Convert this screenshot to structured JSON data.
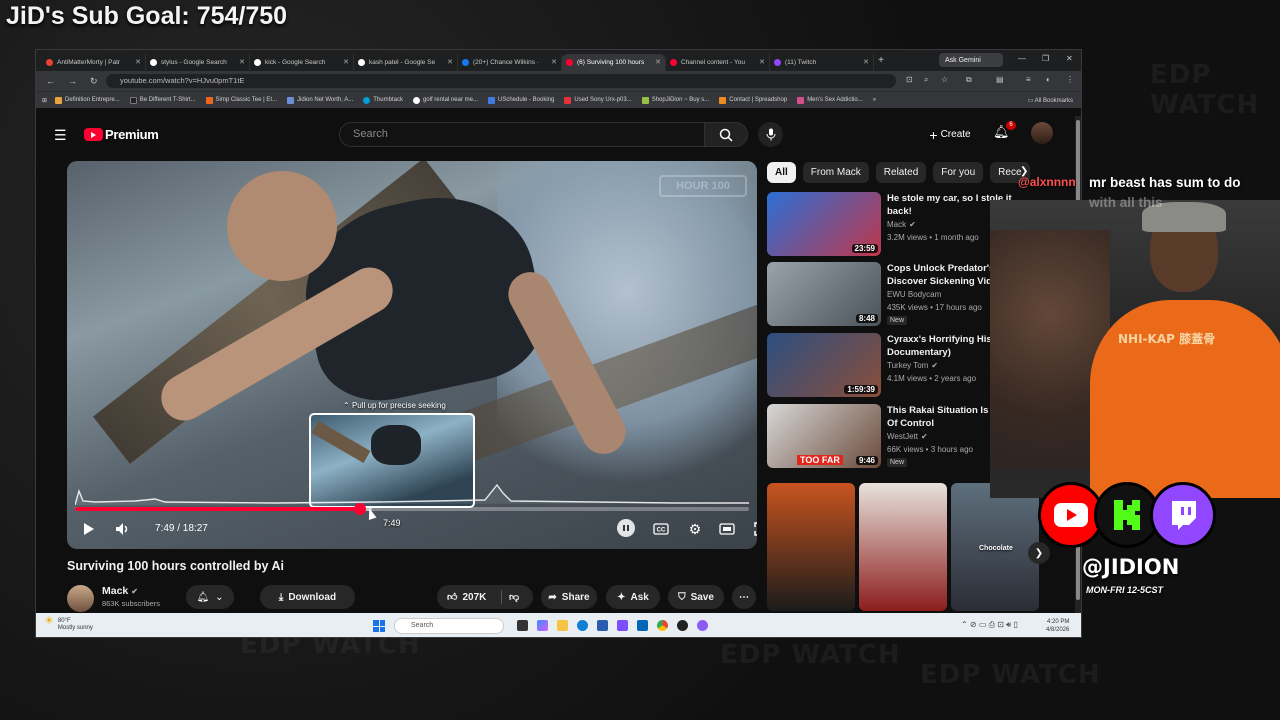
{
  "overlay": {
    "goal": "JiD's Sub Goal: 754/750",
    "chat_user": "@alxnnnn",
    "chat_message": "mr beast has sum to do",
    "chat_message_2": "with all this",
    "handle": "@JIDION",
    "schedule": "MON-FRI 12-5CST",
    "shirt_text": "NHI-KAP 膝蓋骨",
    "watermark": "EDP WATCH"
  },
  "browser": {
    "tabs": [
      {
        "label": "AntiMatterMorty | Patr",
        "color": "#e94235"
      },
      {
        "label": "stylus - Google Search",
        "color": "#ffffff"
      },
      {
        "label": "kick - Google Search",
        "color": "#ffffff"
      },
      {
        "label": "kash patel - Google Se",
        "color": "#ffffff"
      },
      {
        "label": "(20+) Chance Wilkins ·",
        "color": "#1877f2"
      },
      {
        "label": "(6) Surviving 100 hours",
        "color": "#ff0033"
      },
      {
        "label": "Channel content - You",
        "color": "#ff0033"
      },
      {
        "label": "(11) Twitch",
        "color": "#9146ff"
      }
    ],
    "gemini": "Ask Gemini",
    "url": "youtube.com/watch?v=HJvu0pmT1tE",
    "bookmarks": [
      "Definition Entrepre...",
      "Be Different T-Shirt...",
      "Simp Classic Tee | Et...",
      "Jidion Net Worth, A...",
      "Thumbtack",
      "golf rental near me...",
      "USchedule - Booking",
      "Used Sony Urx-p03...",
      "ShopJiDion ~ Buy s...",
      "Contact | Spreadshop",
      "Men's Sex Addictio..."
    ],
    "all_bookmarks": "All Bookmarks"
  },
  "youtube": {
    "logo": "Premium",
    "search_placeholder": "Search",
    "create": "Create",
    "notif_count": "6",
    "player": {
      "watermark": "HOUR 100",
      "seek_hint": "Pull up for precise seeking",
      "preview_time": "7:49",
      "time": "7:49 / 18:27",
      "progress": 0.4233,
      "buffered": 0.44
    },
    "video_title": "Surviving 100 hours controlled by Ai",
    "channel": "Mack",
    "subscribers": "863K subscribers",
    "download": "Download",
    "likes": "207K",
    "share": "Share",
    "ask": "Ask",
    "save": "Save",
    "chips": [
      "All",
      "From Mack",
      "Related",
      "For you",
      "Rece"
    ],
    "recommendations": [
      {
        "title": "He stole my car, so I stole it back!",
        "channel": "Mack",
        "verified": true,
        "meta": "3.2M views • 1 month ago",
        "duration": "23:59",
        "new": false,
        "color1": "#2b6fd6",
        "color2": "#c0364a"
      },
      {
        "title": "Cops Unlock Predator's Ph... Discover Sickening Video",
        "channel": "EWU Bodycam",
        "verified": false,
        "meta": "435K views • 17 hours ago",
        "duration": "8:48",
        "new": true,
        "color1": "#9aa3ab",
        "color2": "#4b5259"
      },
      {
        "title": "Cyraxx's Horrifying History (... Documentary)",
        "channel": "Turkey Tom",
        "verified": true,
        "meta": "4.1M views • 2 years ago",
        "duration": "1:59:39",
        "new": false,
        "color1": "#2c4f80",
        "color2": "#8a4e3a"
      },
      {
        "title": "This Rakai Situation Is Ge... Out Of Control",
        "channel": "WestJett",
        "verified": true,
        "meta": "66K views • 3 hours ago",
        "duration": "9:46",
        "new": true,
        "color1": "#d8d8d8",
        "color2": "#6a4a3a",
        "thumb_text": "TOO FAR"
      }
    ],
    "shorts": [
      {
        "label": "",
        "color1": "#c8541f",
        "color2": "#1b1b1b"
      },
      {
        "label": "",
        "color1": "#e8e2dc",
        "color2": "#8c1d1d"
      },
      {
        "label": "Chocolate",
        "color1": "#5e6f7d",
        "color2": "#2b2d35"
      }
    ]
  },
  "taskbar": {
    "temp": "80°F",
    "weather": "Mostly sunny",
    "search": "Search",
    "time": "4:20 PM",
    "date": "4/8/2026"
  }
}
